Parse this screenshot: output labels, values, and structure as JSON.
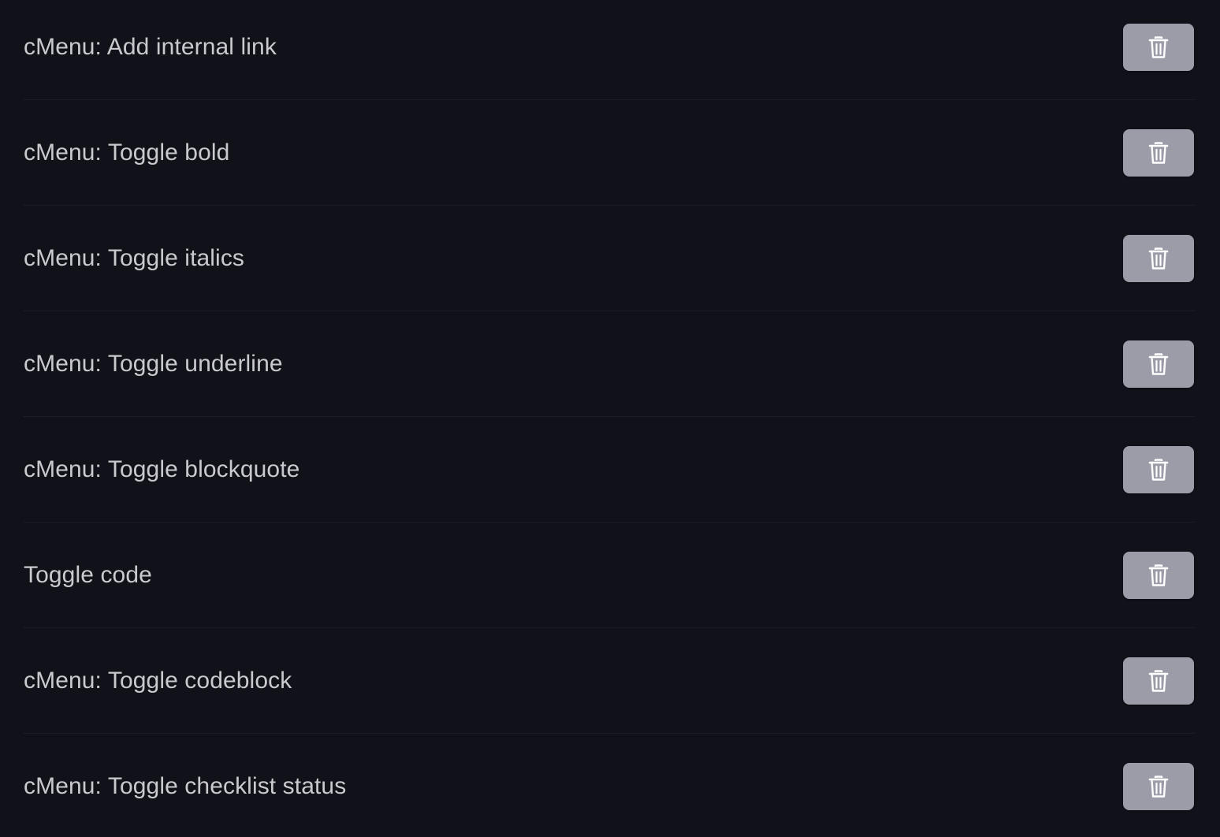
{
  "colors": {
    "background": "#11111a",
    "text": "#c9c9ce",
    "button_bg": "#9b9ca8",
    "icon": "#ffffff",
    "divider": "#1d1d27"
  },
  "commands": [
    {
      "label": "cMenu: Add internal link",
      "action_icon": "trash-icon"
    },
    {
      "label": "cMenu: Toggle bold",
      "action_icon": "trash-icon"
    },
    {
      "label": "cMenu: Toggle italics",
      "action_icon": "trash-icon"
    },
    {
      "label": "cMenu: Toggle underline",
      "action_icon": "trash-icon"
    },
    {
      "label": "cMenu: Toggle blockquote",
      "action_icon": "trash-icon"
    },
    {
      "label": "Toggle code",
      "action_icon": "trash-icon"
    },
    {
      "label": "cMenu: Toggle codeblock",
      "action_icon": "trash-icon"
    },
    {
      "label": "cMenu: Toggle checklist status",
      "action_icon": "trash-icon"
    }
  ]
}
